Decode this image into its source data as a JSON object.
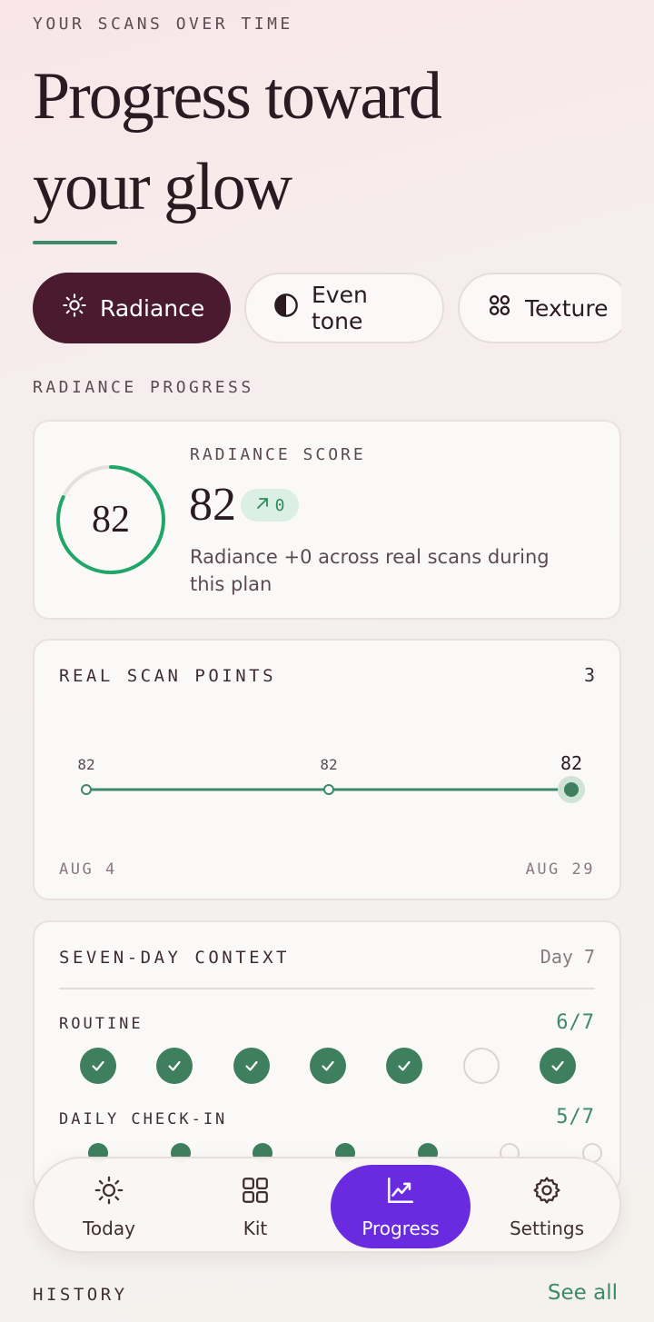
{
  "header": {
    "eyebrow": "YOUR SCANS OVER TIME",
    "title_line1": "Progress toward",
    "title_line2": "your glow"
  },
  "chips": [
    {
      "label": "Radiance",
      "icon": "sun-icon",
      "active": true
    },
    {
      "label": "Even tone",
      "icon": "half-circle-icon",
      "active": false
    },
    {
      "label": "Texture",
      "icon": "dots-grid-icon",
      "active": false
    }
  ],
  "section_label": "RADIANCE PROGRESS",
  "score_card": {
    "ring_value": "82",
    "ring_fraction": 0.82,
    "label": "RADIANCE SCORE",
    "value": "82",
    "delta": "0",
    "description": "Radiance +0 across real scans during this plan"
  },
  "scan_points": {
    "title": "REAL SCAN POINTS",
    "count": "3",
    "start_label": "AUG 4",
    "end_label": "AUG 29",
    "points": [
      {
        "label": "82",
        "value": 82
      },
      {
        "label": "82",
        "value": 82
      },
      {
        "label": "82",
        "value": 82
      }
    ]
  },
  "context": {
    "title": "SEVEN-DAY CONTEXT",
    "day": "Day 7",
    "routine": {
      "label": "ROUTINE",
      "count": "6/7",
      "days": [
        true,
        true,
        true,
        true,
        true,
        false,
        true
      ]
    },
    "checkin": {
      "label": "DAILY CHECK-IN",
      "count": "5/7",
      "days": [
        true,
        true,
        true,
        true,
        true,
        false,
        false
      ]
    }
  },
  "nav": {
    "today": "Today",
    "kit": "Kit",
    "progress": "Progress",
    "settings": "Settings"
  },
  "history": {
    "label": "HISTORY",
    "see_all": "See all"
  },
  "colors": {
    "accent_plum": "#4a1a2e",
    "accent_green": "#3d8a68",
    "ring_green": "#1fa76a",
    "nav_active": "#6a2be0"
  }
}
